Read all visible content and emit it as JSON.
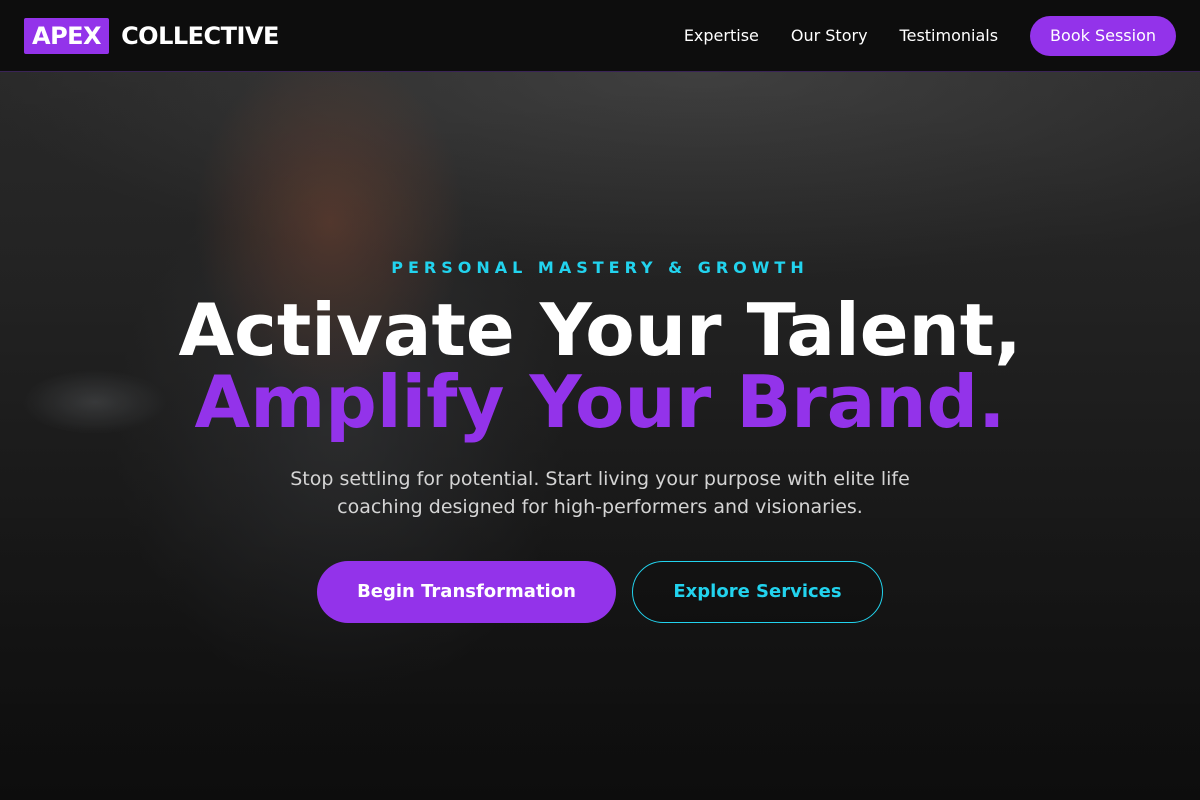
{
  "header": {
    "logo_mark": "APEX",
    "logo_word": "COLLECTIVE",
    "nav": [
      {
        "label": "Expertise"
      },
      {
        "label": "Our Story"
      },
      {
        "label": "Testimonials"
      }
    ],
    "cta_label": "Book Session"
  },
  "hero": {
    "eyebrow": "PERSONAL MASTERY & GROWTH",
    "headline_line_1": "Activate Your Talent,",
    "headline_line_2": "Amplify Your Brand.",
    "subcopy": "Stop settling for potential. Start living your purpose with elite life coaching designed for high-performers and visionaries.",
    "primary_button": "Begin Transformation",
    "secondary_button": "Explore Services"
  },
  "colors": {
    "accent_purple": "#9333ea",
    "accent_cyan": "#22d3ee",
    "header_bg": "#0d0d0d",
    "text_white": "#ffffff",
    "text_muted": "#d4d4d4"
  }
}
